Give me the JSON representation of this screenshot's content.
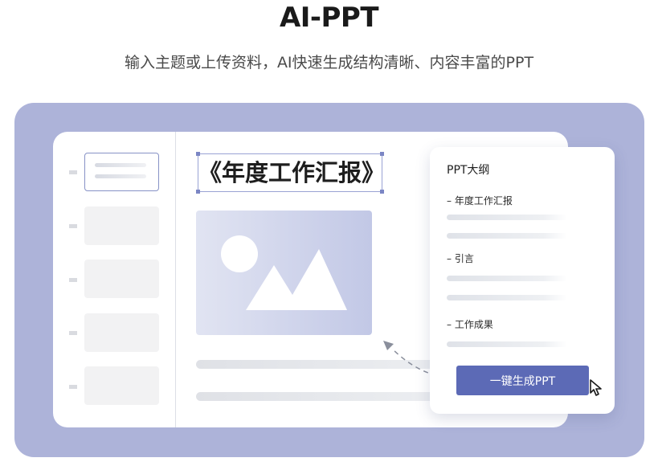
{
  "header": {
    "title": "AI-PPT",
    "subtitle": "输入主题或上传资料，AI快速生成结构清晰、内容丰富的PPT"
  },
  "editor": {
    "slide_heading": "《年度工作汇报》"
  },
  "outline": {
    "title": "PPT大纲",
    "items": [
      "– 年度工作汇报",
      "– 引言",
      "– 工作成果"
    ]
  },
  "actions": {
    "generate_label": "一键生成PPT"
  },
  "colors": {
    "stage_bg": "#adb3d9",
    "accent": "#5c6ab6",
    "selection": "#8792c6"
  },
  "icons": {
    "image_placeholder": "image-placeholder-icon",
    "cursor": "mouse-pointer-icon",
    "arrow": "dashed-curved-arrow-icon"
  }
}
